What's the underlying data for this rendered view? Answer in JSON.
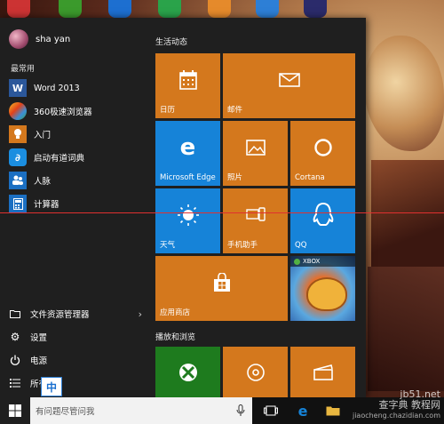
{
  "user": {
    "name": "sha yan"
  },
  "sections": {
    "most_used": "最常用",
    "group1": "生活动态",
    "group2": "播放和浏览"
  },
  "apps": [
    {
      "label": "Word 2013",
      "icon": "word-icon",
      "color": "#2b579a",
      "glyph": "W"
    },
    {
      "label": "360极速浏览器",
      "icon": "browser-360-icon",
      "color": "#3aa04a",
      "glyph": "◉"
    },
    {
      "label": "入门",
      "icon": "lightbulb-icon",
      "color": "#1b6fc2",
      "glyph": "💡"
    },
    {
      "label": "启动有道词典",
      "icon": "youdao-icon",
      "color": "#1b8ee0",
      "glyph": "∂"
    },
    {
      "label": "人脉",
      "icon": "people-icon",
      "color": "#1b6fc2",
      "glyph": "👥"
    },
    {
      "label": "计算器",
      "icon": "calculator-icon",
      "color": "#1b6fc2",
      "glyph": "▦"
    }
  ],
  "system": [
    {
      "label": "文件资源管理器",
      "icon": "folder-icon",
      "glyph": "🗀",
      "has_chevron": true
    },
    {
      "label": "设置",
      "icon": "gear-icon",
      "glyph": "⚙",
      "has_chevron": false
    },
    {
      "label": "电源",
      "icon": "power-icon",
      "glyph": "⏻",
      "has_chevron": false
    },
    {
      "label": "所有",
      "icon": "all-apps-icon",
      "glyph": "☰",
      "has_chevron": false
    }
  ],
  "chevron": "›",
  "ime": "中",
  "tiles": {
    "calendar": "日历",
    "mail": "邮件",
    "edge": "Microsoft Edge",
    "photos": "照片",
    "cortana": "Cortana",
    "weather": "天气",
    "phone": "手机助手",
    "qq": "QQ",
    "store": "应用商店",
    "xbox_label": "XBOX"
  },
  "taskbar": {
    "search_placeholder": "有问题尽管问我"
  },
  "watermark": {
    "line1": "jb51.net",
    "line2": "查字典 教程网",
    "line3": "jiaocheng.chazidian.com"
  },
  "colors": {
    "tile_orange": "#d4781d",
    "tile_blue": "#1683d8",
    "tile_green": "#1e7b1e",
    "menu_bg": "#1f1f1f"
  }
}
